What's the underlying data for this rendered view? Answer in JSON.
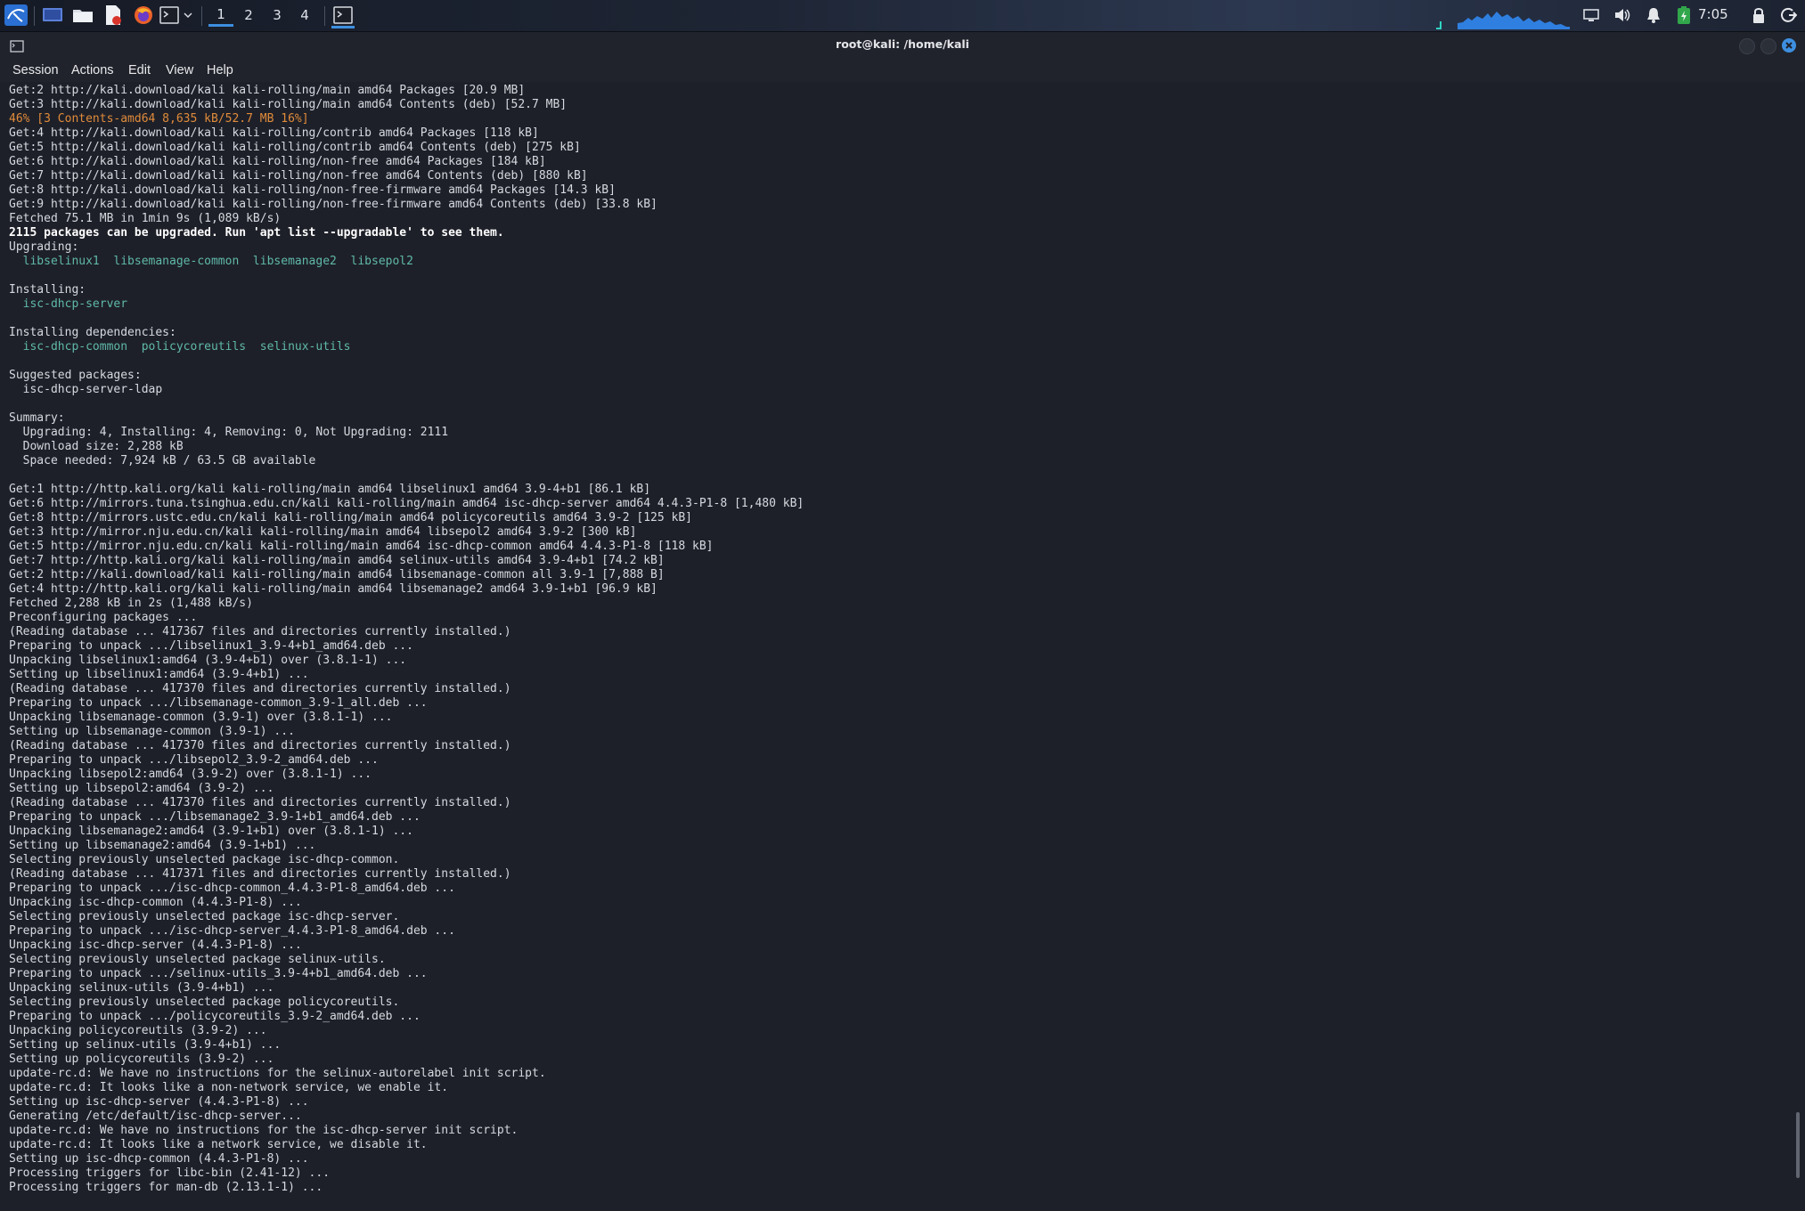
{
  "taskbar": {
    "workspaces": [
      "1",
      "2",
      "3",
      "4"
    ],
    "active_workspace": "1",
    "clock": "7:05",
    "icons": [
      "kali-menu-icon",
      "desktop-icon",
      "file-manager-icon",
      "text-editor-icon",
      "firefox-icon",
      "terminal-icon",
      "dropdown-icon",
      "terminal-task-icon",
      "network-monitor-icon",
      "volume-icon",
      "notifications-icon",
      "battery-icon",
      "lock-icon",
      "logout-icon"
    ]
  },
  "window": {
    "title": "root@kali: /home/kali",
    "menu": [
      "Session",
      "Actions",
      "Edit",
      "View",
      "Help"
    ]
  },
  "colors": {
    "progress_line": "#e08b3a",
    "package_name": "#5fb9a8",
    "close_button": "#3d8fe0",
    "active_workspace": "#3d8fe0"
  },
  "terminal": {
    "lines": [
      {
        "text": "Get:2 http://kali.download/kali kali-rolling/main amd64 Packages [20.9 MB]",
        "style": "normal"
      },
      {
        "text": "Get:3 http://kali.download/kali kali-rolling/main amd64 Contents (deb) [52.7 MB]",
        "style": "normal"
      },
      {
        "text": "46% [3 Contents-amd64 8,635 kB/52.7 MB 16%]",
        "style": "orange"
      },
      {
        "text": "Get:4 http://kali.download/kali kali-rolling/contrib amd64 Packages [118 kB]",
        "style": "normal"
      },
      {
        "text": "Get:5 http://kali.download/kali kali-rolling/contrib amd64 Contents (deb) [275 kB]",
        "style": "normal"
      },
      {
        "text": "Get:6 http://kali.download/kali kali-rolling/non-free amd64 Packages [184 kB]",
        "style": "normal"
      },
      {
        "text": "Get:7 http://kali.download/kali kali-rolling/non-free amd64 Contents (deb) [880 kB]",
        "style": "normal"
      },
      {
        "text": "Get:8 http://kali.download/kali kali-rolling/non-free-firmware amd64 Packages [14.3 kB]",
        "style": "normal"
      },
      {
        "text": "Get:9 http://kali.download/kali kali-rolling/non-free-firmware amd64 Contents (deb) [33.8 kB]",
        "style": "normal"
      },
      {
        "text": "Fetched 75.1 MB in 1min 9s (1,089 kB/s)",
        "style": "normal"
      },
      {
        "text": "2115 packages can be upgraded. Run 'apt list --upgradable' to see them.",
        "style": "bold"
      },
      {
        "text": "Upgrading:",
        "style": "normal"
      },
      {
        "text": "  libselinux1  libsemanage-common  libsemanage2  libsepol2",
        "style": "pkg"
      },
      {
        "text": "",
        "style": "normal"
      },
      {
        "text": "Installing:",
        "style": "normal"
      },
      {
        "text": "  isc-dhcp-server",
        "style": "pkg"
      },
      {
        "text": "",
        "style": "normal"
      },
      {
        "text": "Installing dependencies:",
        "style": "normal"
      },
      {
        "text": "  isc-dhcp-common  policycoreutils  selinux-utils",
        "style": "pkg"
      },
      {
        "text": "",
        "style": "normal"
      },
      {
        "text": "Suggested packages:",
        "style": "normal"
      },
      {
        "text": "  isc-dhcp-server-ldap",
        "style": "normal"
      },
      {
        "text": "",
        "style": "normal"
      },
      {
        "text": "Summary:",
        "style": "normal"
      },
      {
        "text": "  Upgrading: 4, Installing: 4, Removing: 0, Not Upgrading: 2111",
        "style": "normal"
      },
      {
        "text": "  Download size: 2,288 kB",
        "style": "normal"
      },
      {
        "text": "  Space needed: 7,924 kB / 63.5 GB available",
        "style": "normal"
      },
      {
        "text": "",
        "style": "normal"
      },
      {
        "text": "Get:1 http://http.kali.org/kali kali-rolling/main amd64 libselinux1 amd64 3.9-4+b1 [86.1 kB]",
        "style": "normal"
      },
      {
        "text": "Get:6 http://mirrors.tuna.tsinghua.edu.cn/kali kali-rolling/main amd64 isc-dhcp-server amd64 4.4.3-P1-8 [1,480 kB]",
        "style": "normal"
      },
      {
        "text": "Get:8 http://mirrors.ustc.edu.cn/kali kali-rolling/main amd64 policycoreutils amd64 3.9-2 [125 kB]",
        "style": "normal"
      },
      {
        "text": "Get:3 http://mirror.nju.edu.cn/kali kali-rolling/main amd64 libsepol2 amd64 3.9-2 [300 kB]",
        "style": "normal"
      },
      {
        "text": "Get:5 http://mirror.nju.edu.cn/kali kali-rolling/main amd64 isc-dhcp-common amd64 4.4.3-P1-8 [118 kB]",
        "style": "normal"
      },
      {
        "text": "Get:7 http://http.kali.org/kali kali-rolling/main amd64 selinux-utils amd64 3.9-4+b1 [74.2 kB]",
        "style": "normal"
      },
      {
        "text": "Get:2 http://kali.download/kali kali-rolling/main amd64 libsemanage-common all 3.9-1 [7,888 B]",
        "style": "normal"
      },
      {
        "text": "Get:4 http://http.kali.org/kali kali-rolling/main amd64 libsemanage2 amd64 3.9-1+b1 [96.9 kB]",
        "style": "normal"
      },
      {
        "text": "Fetched 2,288 kB in 2s (1,488 kB/s)",
        "style": "normal"
      },
      {
        "text": "Preconfiguring packages ...",
        "style": "normal"
      },
      {
        "text": "(Reading database ... 417367 files and directories currently installed.)",
        "style": "normal"
      },
      {
        "text": "Preparing to unpack .../libselinux1_3.9-4+b1_amd64.deb ...",
        "style": "normal"
      },
      {
        "text": "Unpacking libselinux1:amd64 (3.9-4+b1) over (3.8.1-1) ...",
        "style": "normal"
      },
      {
        "text": "Setting up libselinux1:amd64 (3.9-4+b1) ...",
        "style": "normal"
      },
      {
        "text": "(Reading database ... 417370 files and directories currently installed.)",
        "style": "normal"
      },
      {
        "text": "Preparing to unpack .../libsemanage-common_3.9-1_all.deb ...",
        "style": "normal"
      },
      {
        "text": "Unpacking libsemanage-common (3.9-1) over (3.8.1-1) ...",
        "style": "normal"
      },
      {
        "text": "Setting up libsemanage-common (3.9-1) ...",
        "style": "normal"
      },
      {
        "text": "(Reading database ... 417370 files and directories currently installed.)",
        "style": "normal"
      },
      {
        "text": "Preparing to unpack .../libsepol2_3.9-2_amd64.deb ...",
        "style": "normal"
      },
      {
        "text": "Unpacking libsepol2:amd64 (3.9-2) over (3.8.1-1) ...",
        "style": "normal"
      },
      {
        "text": "Setting up libsepol2:amd64 (3.9-2) ...",
        "style": "normal"
      },
      {
        "text": "(Reading database ... 417370 files and directories currently installed.)",
        "style": "normal"
      },
      {
        "text": "Preparing to unpack .../libsemanage2_3.9-1+b1_amd64.deb ...",
        "style": "normal"
      },
      {
        "text": "Unpacking libsemanage2:amd64 (3.9-1+b1) over (3.8.1-1) ...",
        "style": "normal"
      },
      {
        "text": "Setting up libsemanage2:amd64 (3.9-1+b1) ...",
        "style": "normal"
      },
      {
        "text": "Selecting previously unselected package isc-dhcp-common.",
        "style": "normal"
      },
      {
        "text": "(Reading database ... 417371 files and directories currently installed.)",
        "style": "normal"
      },
      {
        "text": "Preparing to unpack .../isc-dhcp-common_4.4.3-P1-8_amd64.deb ...",
        "style": "normal"
      },
      {
        "text": "Unpacking isc-dhcp-common (4.4.3-P1-8) ...",
        "style": "normal"
      },
      {
        "text": "Selecting previously unselected package isc-dhcp-server.",
        "style": "normal"
      },
      {
        "text": "Preparing to unpack .../isc-dhcp-server_4.4.3-P1-8_amd64.deb ...",
        "style": "normal"
      },
      {
        "text": "Unpacking isc-dhcp-server (4.4.3-P1-8) ...",
        "style": "normal"
      },
      {
        "text": "Selecting previously unselected package selinux-utils.",
        "style": "normal"
      },
      {
        "text": "Preparing to unpack .../selinux-utils_3.9-4+b1_amd64.deb ...",
        "style": "normal"
      },
      {
        "text": "Unpacking selinux-utils (3.9-4+b1) ...",
        "style": "normal"
      },
      {
        "text": "Selecting previously unselected package policycoreutils.",
        "style": "normal"
      },
      {
        "text": "Preparing to unpack .../policycoreutils_3.9-2_amd64.deb ...",
        "style": "normal"
      },
      {
        "text": "Unpacking policycoreutils (3.9-2) ...",
        "style": "normal"
      },
      {
        "text": "Setting up selinux-utils (3.9-4+b1) ...",
        "style": "normal"
      },
      {
        "text": "Setting up policycoreutils (3.9-2) ...",
        "style": "normal"
      },
      {
        "text": "update-rc.d: We have no instructions for the selinux-autorelabel init script.",
        "style": "normal"
      },
      {
        "text": "update-rc.d: It looks like a non-network service, we enable it.",
        "style": "normal"
      },
      {
        "text": "Setting up isc-dhcp-server (4.4.3-P1-8) ...",
        "style": "normal"
      },
      {
        "text": "Generating /etc/default/isc-dhcp-server...",
        "style": "normal"
      },
      {
        "text": "update-rc.d: We have no instructions for the isc-dhcp-server init script.",
        "style": "normal"
      },
      {
        "text": "update-rc.d: It looks like a network service, we disable it.",
        "style": "normal"
      },
      {
        "text": "Setting up isc-dhcp-common (4.4.3-P1-8) ...",
        "style": "normal"
      },
      {
        "text": "Processing triggers for libc-bin (2.41-12) ...",
        "style": "normal"
      },
      {
        "text": "Processing triggers for man-db (2.13.1-1) ...",
        "style": "normal"
      }
    ]
  }
}
